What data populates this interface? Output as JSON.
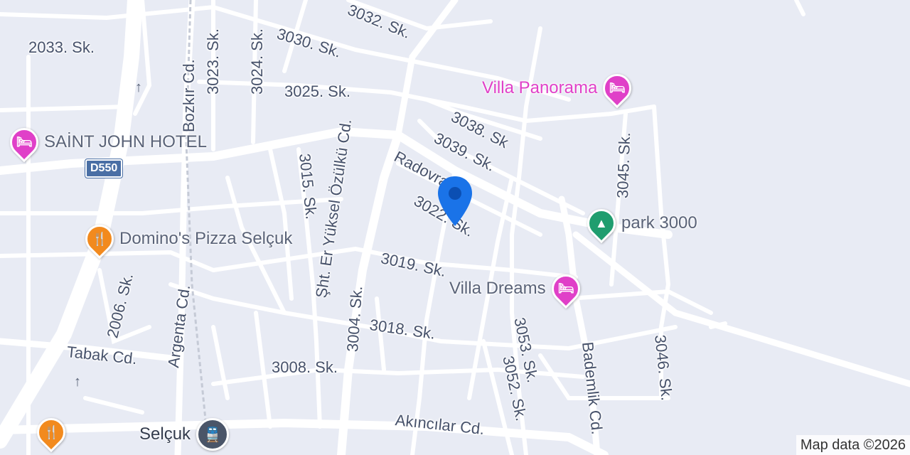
{
  "map": {
    "highway_shield": "D550",
    "attribution": "Map data ©2026",
    "colors": {
      "background": "#e8ebf4",
      "road": "#ffffff",
      "highway": "#ffffff",
      "hotel": "#e040c8",
      "restaurant": "#f28a1e",
      "park": "#1f9d6e",
      "transit": "#4a5568",
      "location_marker": "#1a73e8"
    },
    "street_labels": [
      "2033. Sk.",
      "3023. Sk.",
      "3024. Sk.",
      "Bozkır Cd.",
      "3030. Sk.",
      "3032. Sk.",
      "3025. Sk.",
      "3038. Sk",
      "3039. Sk.",
      "Radovra Cd.",
      "3015. Sk.",
      "Şht. Er Yüksel Özülkü Cd.",
      "3022. Sk.",
      "3045. Sk.",
      "3019. Sk.",
      "2006. Sk.",
      "Argenta Cd.",
      "3004. Sk.",
      "3018. Sk.",
      "3053. Sk.",
      "3052. Sk.",
      "Bademlik Cd.",
      "3046. Sk.",
      "Tabak Cd.",
      "3008. Sk.",
      "Akıncılar Cd."
    ],
    "pois": [
      {
        "name": "Villa Panorama",
        "category": "hotel",
        "icon": "bed-icon"
      },
      {
        "name": "SAİNT JOHN HOTEL",
        "category": "hotel",
        "icon": "bed-icon"
      },
      {
        "name": "Domino's Pizza Selçuk",
        "category": "restaurant",
        "icon": "fork-knife-icon"
      },
      {
        "name": "park 3000",
        "category": "park",
        "icon": "tree-icon"
      },
      {
        "name": "Villa Dreams",
        "category": "hotel",
        "icon": "bed-icon"
      },
      {
        "name": "Selçuk",
        "category": "train-station",
        "icon": "train-icon"
      },
      {
        "name": "",
        "category": "restaurant",
        "icon": "fork-knife-icon"
      }
    ]
  }
}
